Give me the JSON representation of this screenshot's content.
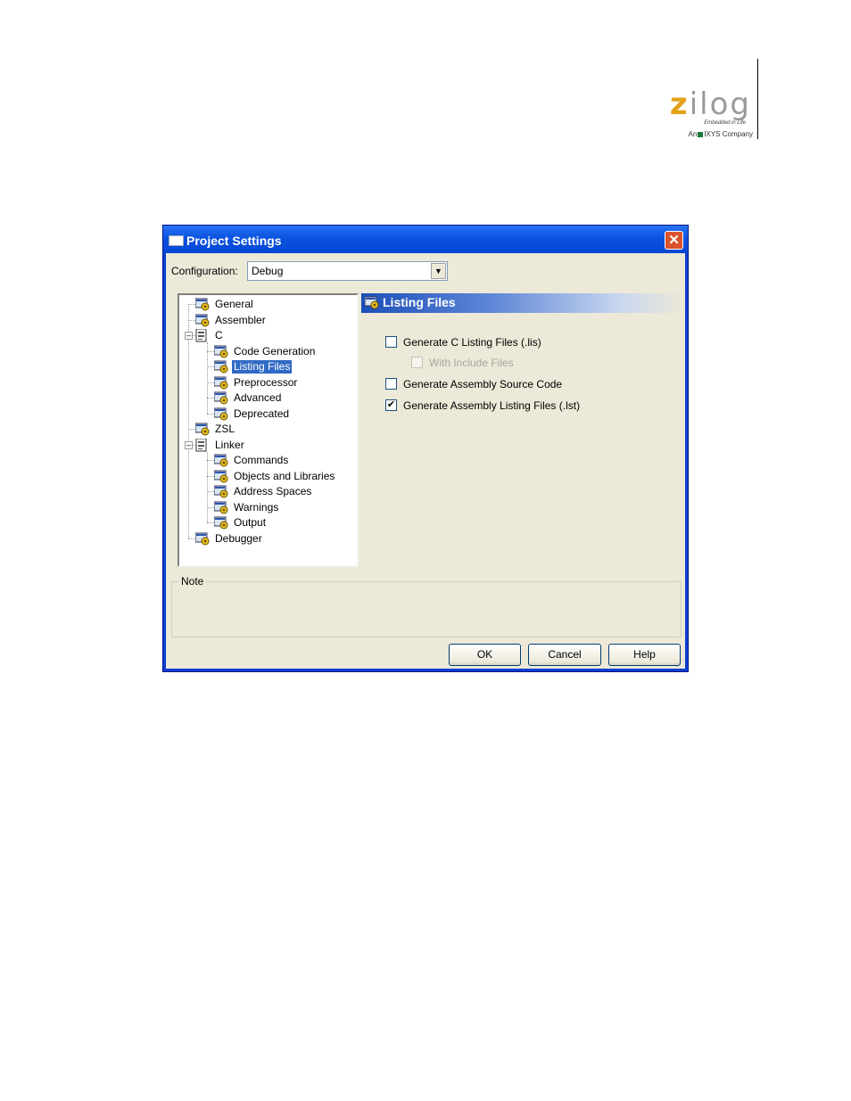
{
  "logo": {
    "word_z": "z",
    "word_rest": "ilog",
    "tagline": "Embedded in Life",
    "company_prefix": "An",
    "company_name": "IXYS",
    "company_suffix": "Company"
  },
  "dialog": {
    "title": "Project Settings",
    "close_symbol": "✕",
    "configuration_label": "Configuration:",
    "configuration_value": "Debug",
    "dropdown_arrow": "▼",
    "tree": [
      {
        "label": "General",
        "level": 0
      },
      {
        "label": "Assembler",
        "level": 0
      },
      {
        "label": "C",
        "level": 0,
        "expanded": true
      },
      {
        "label": "Code Generation",
        "level": 1
      },
      {
        "label": "Listing Files",
        "level": 1,
        "selected": true
      },
      {
        "label": "Preprocessor",
        "level": 1
      },
      {
        "label": "Advanced",
        "level": 1
      },
      {
        "label": "Deprecated",
        "level": 1
      },
      {
        "label": "ZSL",
        "level": 0
      },
      {
        "label": "Linker",
        "level": 0,
        "expanded": true
      },
      {
        "label": "Commands",
        "level": 1
      },
      {
        "label": "Objects and Libraries",
        "level": 1
      },
      {
        "label": "Address Spaces",
        "level": 1
      },
      {
        "label": "Warnings",
        "level": 1
      },
      {
        "label": "Output",
        "level": 1
      },
      {
        "label": "Debugger",
        "level": 0
      }
    ],
    "panel_title": "Listing Files",
    "options": [
      {
        "label": "Generate C Listing Files (.lis)",
        "checked": false,
        "enabled": true
      },
      {
        "label": "With Include Files",
        "checked": false,
        "enabled": false
      },
      {
        "label": "Generate Assembly Source Code",
        "checked": false,
        "enabled": true
      },
      {
        "label": "Generate Assembly Listing Files (.lst)",
        "checked": true,
        "enabled": true
      }
    ],
    "check_mark": "✔",
    "note_label": "Note",
    "buttons": {
      "ok": "OK",
      "cancel": "Cancel",
      "help": "Help"
    }
  }
}
